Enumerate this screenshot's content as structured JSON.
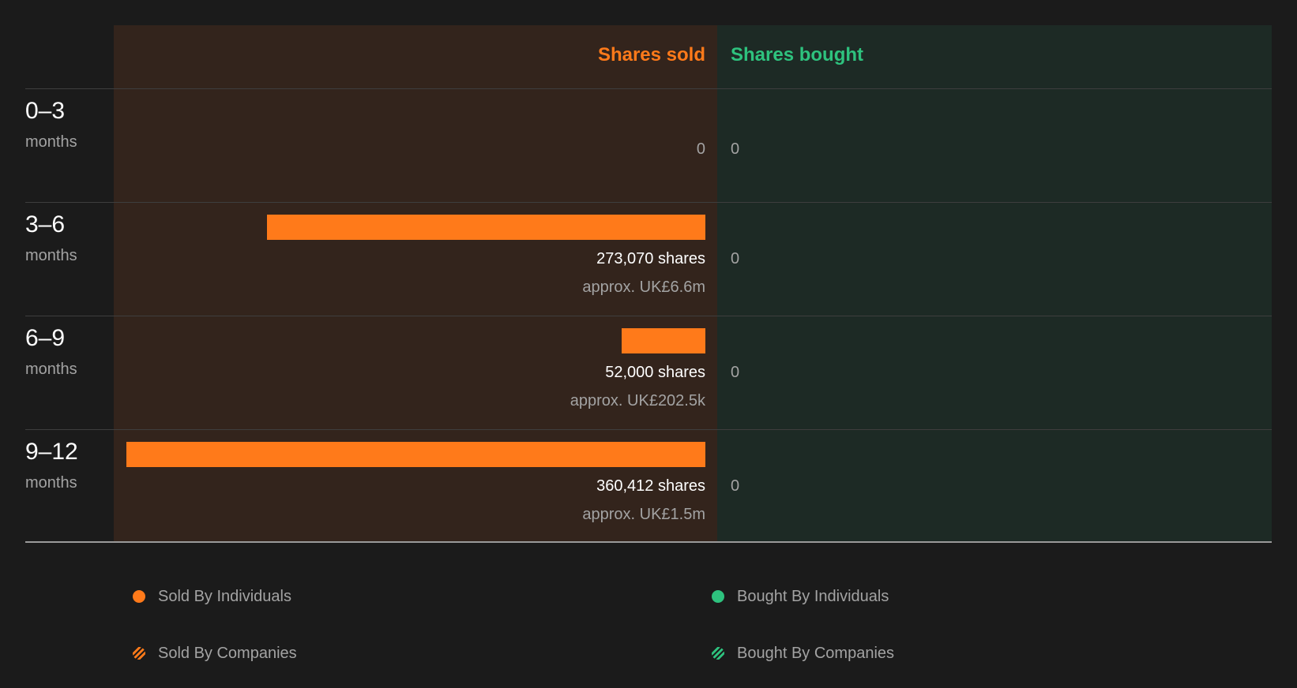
{
  "chart_data": {
    "type": "bar",
    "orientation": "horizontal-diverging",
    "headers": {
      "sold": "Shares sold",
      "bought": "Shares bought"
    },
    "unit_label": "months",
    "categories": [
      "0–3",
      "3–6",
      "6–9",
      "9–12"
    ],
    "series": [
      {
        "name": "Shares sold",
        "values": [
          0,
          273070,
          52000,
          360412
        ],
        "shares_labels": [
          "0",
          "273,070 shares",
          "52,000 shares",
          "360,412 shares"
        ],
        "approx_labels": [
          "",
          "approx. UK£6.6m",
          "approx. UK£202.5k",
          "approx. UK£1.5m"
        ]
      },
      {
        "name": "Shares bought",
        "values": [
          0,
          0,
          0,
          0
        ],
        "labels": [
          "0",
          "0",
          "0",
          "0"
        ]
      }
    ],
    "xlim": [
      0,
      360412
    ],
    "legend": [
      {
        "label": "Sold By Individuals",
        "color": "#ff7a1a",
        "pattern": "solid"
      },
      {
        "label": "Bought By Individuals",
        "color": "#2ec27e",
        "pattern": "solid"
      },
      {
        "label": "Sold By Companies",
        "color": "#ff7a1a",
        "pattern": "striped"
      },
      {
        "label": "Bought By Companies",
        "color": "#2ec27e",
        "pattern": "striped"
      }
    ],
    "legend_position": "bottom"
  },
  "colors": {
    "background": "#1b1b1b",
    "sold_accent": "#ff7a1a",
    "bought_accent": "#2ec27e",
    "sold_panel": "#33241c",
    "bought_panel": "#1d2a25"
  }
}
